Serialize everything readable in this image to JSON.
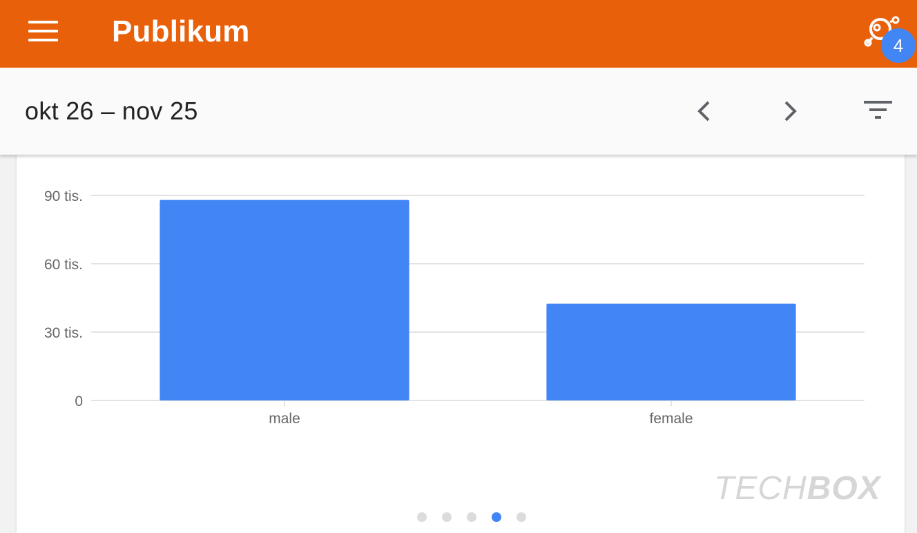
{
  "app_bar": {
    "title": "Publikum",
    "menu_icon": "menu-icon",
    "insights_icon": "insights-icon",
    "insights_badge": "4",
    "background_color": "#e8610a"
  },
  "date_bar": {
    "range_label": "okt 26 – nov 25",
    "prev_icon": "chevron-left-icon",
    "next_icon": "chevron-right-icon",
    "filter_icon": "filter-icon"
  },
  "chart_data": {
    "type": "bar",
    "categories": [
      "male",
      "female"
    ],
    "values": [
      88000,
      42500
    ],
    "ylim": [
      0,
      90000
    ],
    "yticks": [
      0,
      30000,
      60000,
      90000
    ],
    "ytick_labels": [
      "0",
      "30 tis.",
      "60 tis.",
      "90 tis."
    ],
    "title": "",
    "xlabel": "",
    "ylabel": "",
    "grid": true,
    "bar_color": "#4285f4"
  },
  "watermark": {
    "part1": "TECH",
    "part2": "BOX"
  },
  "pager": {
    "count": 5,
    "active_index": 3
  }
}
